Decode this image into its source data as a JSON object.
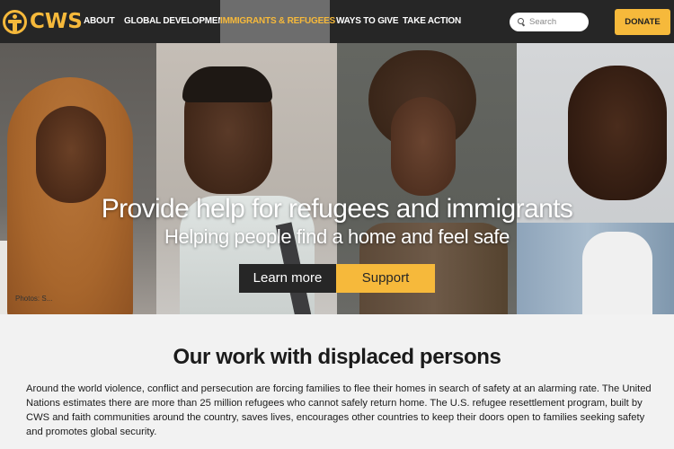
{
  "nav": {
    "logo_text": "CWS",
    "items": [
      {
        "label": "ABOUT",
        "active": false
      },
      {
        "label": "GLOBAL DEVELOPMENT",
        "active": false
      },
      {
        "label": "IMMIGRANTS & REFUGEES",
        "active": true
      },
      {
        "label": "WAYS TO GIVE",
        "active": false
      },
      {
        "label": "TAKE ACTION",
        "active": false
      }
    ],
    "search_placeholder": "Search",
    "search_value": "",
    "donate_label": "DONATE"
  },
  "hero": {
    "title": "Provide help for refugees and immigrants",
    "subtitle": "Helping people find a home and feel safe",
    "learn_more_label": "Learn more",
    "support_label": "Support",
    "photo_credit": "Photos: S..."
  },
  "content": {
    "heading": "Our work with displaced persons",
    "body": "Around the world violence, conflict and persecution are forcing families to flee their homes in search of safety at an alarming rate. The United Nations estimates there are more than 25 million refugees who cannot safely return home. The U.S. refugee resettlement program, built by CWS and faith communities around the country, saves lives, encourages other countries to keep their doors open to families seeking safety and promotes global security."
  },
  "colors": {
    "brand_yellow": "#f6b93b",
    "nav_bg": "#262626",
    "nav_active_bg": "#6d6d6d",
    "page_bg": "#f2f2f2"
  }
}
